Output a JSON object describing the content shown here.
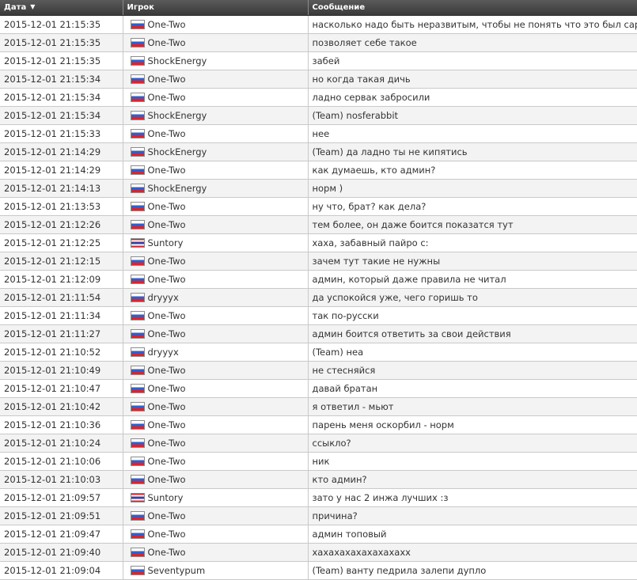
{
  "table": {
    "headers": [
      {
        "label": "Дата",
        "sort_indicator": "▼"
      },
      {
        "label": "Игрок"
      },
      {
        "label": "Сообщение"
      }
    ],
    "rows": [
      {
        "date": "2015-12-01 21:15:35",
        "player": "One-Two",
        "flag": "ru-flag",
        "message": "насколько надо быть неразвитым, чтобы не понять что это был сарказм?"
      },
      {
        "date": "2015-12-01 21:15:35",
        "player": "One-Two",
        "flag": "ru-flag",
        "message": "позволяет себе такое"
      },
      {
        "date": "2015-12-01 21:15:35",
        "player": "ShockEnergy",
        "flag": "ru-flag",
        "message": "забей"
      },
      {
        "date": "2015-12-01 21:15:34",
        "player": "One-Two",
        "flag": "ru-flag",
        "message": "но когда такая дичь"
      },
      {
        "date": "2015-12-01 21:15:34",
        "player": "One-Two",
        "flag": "ru-flag",
        "message": "ладно сервак забросили"
      },
      {
        "date": "2015-12-01 21:15:34",
        "player": "ShockEnergy",
        "flag": "ru-flag",
        "message": "(Team) nosferabbit"
      },
      {
        "date": "2015-12-01 21:15:33",
        "player": "One-Two",
        "flag": "ru-flag",
        "message": "нее"
      },
      {
        "date": "2015-12-01 21:14:29",
        "player": "ShockEnergy",
        "flag": "ru-flag",
        "message": "(Team) да ладно ты не кипятись"
      },
      {
        "date": "2015-12-01 21:14:29",
        "player": "One-Two",
        "flag": "ru-flag",
        "message": "как думаешь, кто админ?"
      },
      {
        "date": "2015-12-01 21:14:13",
        "player": "ShockEnergy",
        "flag": "ru-flag",
        "message": "норм )"
      },
      {
        "date": "2015-12-01 21:13:53",
        "player": "One-Two",
        "flag": "ru-flag",
        "message": "ну что, брат? как дела?"
      },
      {
        "date": "2015-12-01 21:12:26",
        "player": "One-Two",
        "flag": "ru-flag",
        "message": "тем более, он даже боится показатся тут"
      },
      {
        "date": "2015-12-01 21:12:25",
        "player": "Suntory",
        "flag": "th-flag",
        "message": "хаха, забавный пайро с:"
      },
      {
        "date": "2015-12-01 21:12:15",
        "player": "One-Two",
        "flag": "ru-flag",
        "message": "зачем тут такие не нужны"
      },
      {
        "date": "2015-12-01 21:12:09",
        "player": "One-Two",
        "flag": "ru-flag",
        "message": "админ, который даже правила не читал"
      },
      {
        "date": "2015-12-01 21:11:54",
        "player": "dryyyx",
        "flag": "ru-flag",
        "message": "да успокойся уже, чего горишь то"
      },
      {
        "date": "2015-12-01 21:11:34",
        "player": "One-Two",
        "flag": "ru-flag",
        "message": "так по-русски"
      },
      {
        "date": "2015-12-01 21:11:27",
        "player": "One-Two",
        "flag": "ru-flag",
        "message": "админ боится ответить за свои действия"
      },
      {
        "date": "2015-12-01 21:10:52",
        "player": "dryyyx",
        "flag": "ru-flag",
        "message": "(Team) неа"
      },
      {
        "date": "2015-12-01 21:10:49",
        "player": "One-Two",
        "flag": "ru-flag",
        "message": "не стесняйся"
      },
      {
        "date": "2015-12-01 21:10:47",
        "player": "One-Two",
        "flag": "ru-flag",
        "message": "давай братан"
      },
      {
        "date": "2015-12-01 21:10:42",
        "player": "One-Two",
        "flag": "ru-flag",
        "message": "я ответил - мьют"
      },
      {
        "date": "2015-12-01 21:10:36",
        "player": "One-Two",
        "flag": "ru-flag",
        "message": "парень меня оскорбил - норм"
      },
      {
        "date": "2015-12-01 21:10:24",
        "player": "One-Two",
        "flag": "ru-flag",
        "message": "ссыкло?"
      },
      {
        "date": "2015-12-01 21:10:06",
        "player": "One-Two",
        "flag": "ru-flag",
        "message": "ник"
      },
      {
        "date": "2015-12-01 21:10:03",
        "player": "One-Two",
        "flag": "ru-flag",
        "message": "кто админ?"
      },
      {
        "date": "2015-12-01 21:09:57",
        "player": "Suntory",
        "flag": "th-flag",
        "message": "зато у нас 2 инжа лучших :з"
      },
      {
        "date": "2015-12-01 21:09:51",
        "player": "One-Two",
        "flag": "ru-flag",
        "message": "причина?"
      },
      {
        "date": "2015-12-01 21:09:47",
        "player": "One-Two",
        "flag": "ru-flag",
        "message": "админ топовый"
      },
      {
        "date": "2015-12-01 21:09:40",
        "player": "One-Two",
        "flag": "ru-flag",
        "message": "хахахахахахахахахх"
      },
      {
        "date": "2015-12-01 21:09:04",
        "player": "Seventypum",
        "flag": "ru-flag",
        "message": "(Team) ванту педрила залепи дупло"
      }
    ]
  }
}
